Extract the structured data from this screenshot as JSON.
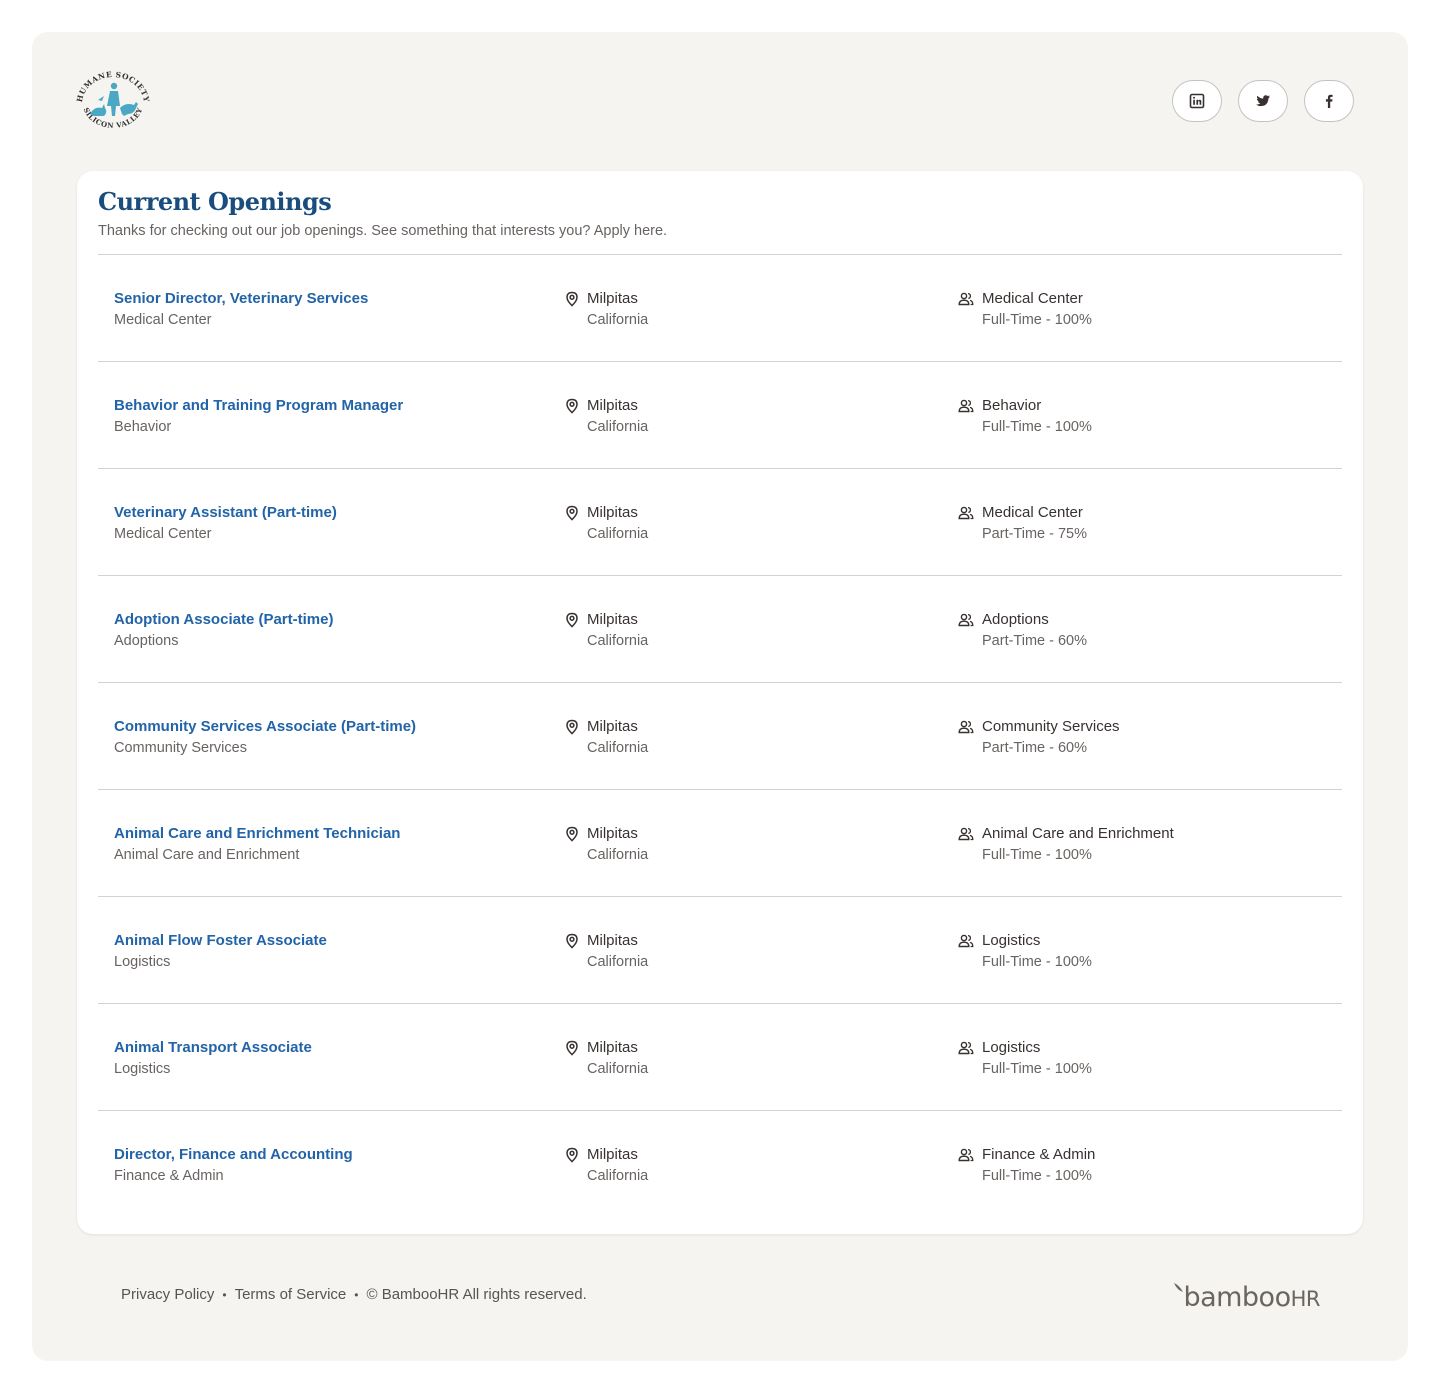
{
  "brand": {
    "logo_top_text": "HUMANE SOCIETY",
    "logo_bottom_text": "SILICON VALLEY"
  },
  "socials": [
    {
      "name": "linkedin",
      "icon": "linkedin-icon"
    },
    {
      "name": "twitter",
      "icon": "twitter-icon"
    },
    {
      "name": "facebook",
      "icon": "facebook-icon"
    }
  ],
  "openings": {
    "title": "Current Openings",
    "subtitle": "Thanks for checking out our job openings. See something that interests you? Apply here."
  },
  "jobs": [
    {
      "title": "Senior Director, Veterinary Services",
      "department": "Medical Center",
      "city": "Milpitas",
      "state": "California",
      "type": "Full-Time - 100%"
    },
    {
      "title": "Behavior and Training Program Manager",
      "department": "Behavior",
      "city": "Milpitas",
      "state": "California",
      "type": "Full-Time - 100%"
    },
    {
      "title": "Veterinary Assistant (Part-time)",
      "department": "Medical Center",
      "city": "Milpitas",
      "state": "California",
      "type": "Part-Time - 75%"
    },
    {
      "title": "Adoption Associate (Part-time)",
      "department": "Adoptions",
      "city": "Milpitas",
      "state": "California",
      "type": "Part-Time - 60%"
    },
    {
      "title": "Community Services Associate (Part-time)",
      "department": "Community Services",
      "city": "Milpitas",
      "state": "California",
      "type": "Part-Time - 60%"
    },
    {
      "title": "Animal Care and Enrichment Technician",
      "department": "Animal Care and Enrichment",
      "city": "Milpitas",
      "state": "California",
      "type": "Full-Time - 100%"
    },
    {
      "title": "Animal Flow Foster Associate",
      "department": "Logistics",
      "city": "Milpitas",
      "state": "California",
      "type": "Full-Time - 100%"
    },
    {
      "title": "Animal Transport Associate",
      "department": "Logistics",
      "city": "Milpitas",
      "state": "California",
      "type": "Full-Time - 100%"
    },
    {
      "title": "Director, Finance and Accounting",
      "department": "Finance & Admin",
      "city": "Milpitas",
      "state": "California",
      "type": "Full-Time - 100%"
    }
  ],
  "footer": {
    "privacy": "Privacy Policy",
    "separator": "•",
    "terms": "Terms of Service",
    "copyright": "© BambooHR All rights reserved.",
    "brand_name": "bamboo",
    "brand_suffix": "HR"
  },
  "colors": {
    "page_bg": "#f5f4f1",
    "title_blue": "#194d7e",
    "link_blue": "#2264a7",
    "logo_teal": "#4aa8c4"
  }
}
